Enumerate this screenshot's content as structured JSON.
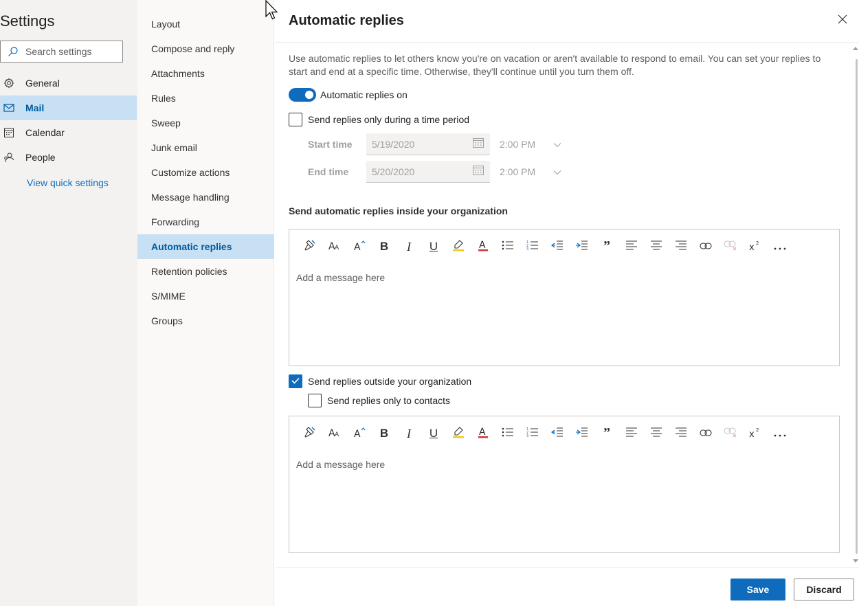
{
  "left_nav": {
    "title": "Settings",
    "search_placeholder": "Search settings",
    "items": [
      {
        "label": "General",
        "icon": "gear-icon"
      },
      {
        "label": "Mail",
        "icon": "mail-icon"
      },
      {
        "label": "Calendar",
        "icon": "calendar-icon"
      },
      {
        "label": "People",
        "icon": "people-icon"
      }
    ],
    "active_item": "Mail",
    "view_quick_settings": "View quick settings"
  },
  "sub_nav": {
    "items": [
      "Layout",
      "Compose and reply",
      "Attachments",
      "Rules",
      "Sweep",
      "Junk email",
      "Customize actions",
      "Message handling",
      "Forwarding",
      "Automatic replies",
      "Retention policies",
      "S/MIME",
      "Groups"
    ],
    "active_item": "Automatic replies"
  },
  "main": {
    "title": "Automatic replies",
    "intro": "Use automatic replies to let others know you're on vacation or aren't available to respond to email. You can set your replies to start and end at a specific time. Otherwise, they'll continue until you turn them off.",
    "toggle_label": "Automatic replies on",
    "toggle_on": true,
    "time_period_label": "Send replies only during a time period",
    "time_period_checked": false,
    "start_time_label": "Start time",
    "start_date": "5/19/2020",
    "start_time": "2:00 PM",
    "end_time_label": "End time",
    "end_date": "5/20/2020",
    "end_time": "2:00 PM",
    "inside_heading": "Send automatic replies inside your organization",
    "inside_placeholder": "Add a message here",
    "outside_label": "Send replies outside your organization",
    "outside_checked": true,
    "contacts_only_label": "Send replies only to contacts",
    "contacts_only_checked": false,
    "outside_placeholder": "Add a message here",
    "save_label": "Save",
    "discard_label": "Discard"
  },
  "toolbar_buttons": [
    "format-painter-icon",
    "font-size-icon",
    "grow-font-icon",
    "bold-icon",
    "italic-icon",
    "underline-icon",
    "highlight-icon",
    "font-color-icon",
    "bullets-icon",
    "numbering-icon",
    "decrease-indent-icon",
    "increase-indent-icon",
    "quote-icon",
    "align-left-icon",
    "align-center-icon",
    "align-right-icon",
    "link-icon",
    "remove-link-icon",
    "superscript-icon",
    "more-options-icon"
  ],
  "colors": {
    "accent": "#0f6cbd",
    "nav_active_bg": "#c7e0f4",
    "nav_active_text": "#005a9e",
    "highlight": "#f2c811",
    "font_color": "#d13438"
  }
}
